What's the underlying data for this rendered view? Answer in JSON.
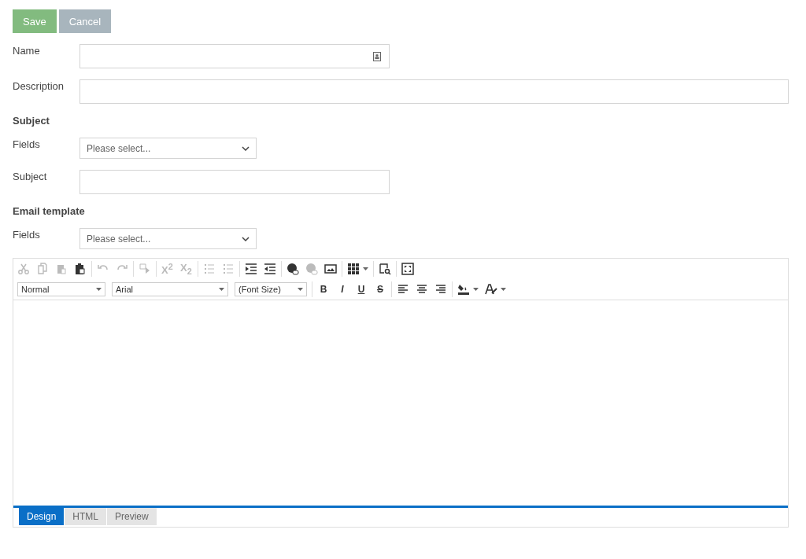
{
  "actions": [
    {
      "label": "Save",
      "kind": "primary"
    },
    {
      "label": "Cancel",
      "kind": "secondary"
    }
  ],
  "fields": [
    {
      "label": "Name",
      "kind": "text"
    },
    {
      "label": "Description",
      "kind": "text"
    }
  ],
  "sections": [
    {
      "heading": "Subject",
      "fields": [
        {
          "label": "Fields",
          "kind": "select",
          "placeholder": "Please select..."
        },
        {
          "label": "Subject",
          "kind": "text"
        }
      ]
    },
    {
      "heading": "Email template",
      "fields": [
        {
          "label": "Fields",
          "kind": "select",
          "placeholder": "Please select..."
        }
      ]
    }
  ],
  "editor": {
    "toolbar_row_1": [
      [
        {
          "kind": "icon",
          "disabled": true
        },
        {
          "kind": "icon",
          "disabled": true
        },
        {
          "kind": "icon",
          "disabled": true
        },
        {
          "kind": "icon",
          "disabled": false
        }
      ],
      [
        {
          "kind": "icon",
          "disabled": true
        },
        {
          "kind": "icon",
          "disabled": true
        }
      ],
      [
        {
          "kind": "icon",
          "disabled": true
        }
      ],
      [
        {
          "kind": "text",
          "label": "X$^{2}$",
          "disabled": true
        },
        {
          "kind": "text",
          "label": "X$_{2}$",
          "disabled": true
        }
      ],
      [
        {
          "kind": "icon",
          "disabled": true
        },
        {
          "kind": "icon",
          "disabled": true
        }
      ],
      [
        {
          "kind": "icon",
          "disabled": false
        },
        {
          "kind": "icon",
          "disabled": false
        }
      ],
      [
        {
          "kind": "icon",
          "disabled": false
        },
        {
          "kind": "icon",
          "disabled": true
        },
        {
          "kind": "icon",
          "disabled": false
        }
      ],
      [
        {
          "kind": "icon",
          "disabled": false
        }
      ],
      [
        {
          "kind": "icon",
          "disabled": false
        }
      ],
      [
        {
          "kind": "icon",
          "disabled": false
        }
      ]
    ],
    "dropdowns": [
      {
        "value": "Normal"
      },
      {
        "value": "Arial"
      },
      {
        "value": "(Font Size)"
      }
    ],
    "toolbar_row_2": [
      [
        {
          "kind": "text",
          "label": "B"
        },
        {
          "kind": "text",
          "label": "I"
        },
        {
          "kind": "text",
          "label": "U"
        },
        {
          "kind": "text",
          "label": "S"
        }
      ],
      [
        {
          "kind": "icon"
        },
        {
          "kind": "icon"
        },
        {
          "kind": "icon"
        }
      ],
      [
        {
          "kind": "icon"
        },
        {
          "kind": "icon"
        }
      ]
    ],
    "tabs": [
      {
        "label": "Design",
        "selected": true
      },
      {
        "label": "HTML",
        "selected": false
      },
      {
        "label": "Preview",
        "selected": false
      }
    ]
  }
}
